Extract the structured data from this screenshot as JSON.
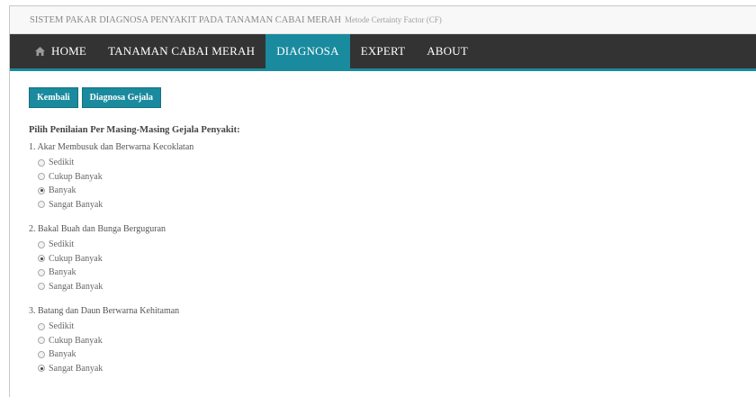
{
  "header": {
    "title": "SISTEM PAKAR DIAGNOSA PENYAKIT PADA TANAMAN CABAI MERAH",
    "subtitle": "Metode Certainty Factor (CF)"
  },
  "nav": {
    "items": [
      {
        "label": "HOME",
        "icon": "home-icon"
      },
      {
        "label": "TANAMAN CABAI MERAH"
      },
      {
        "label": "DIAGNOSA"
      },
      {
        "label": "EXPERT"
      },
      {
        "label": "ABOUT"
      }
    ],
    "active_index": 2,
    "accent_color": "#1a8a9e",
    "bar_color": "#333333"
  },
  "buttons": {
    "back": "Kembali",
    "diagnose": "Diagnosa Gejala"
  },
  "form": {
    "heading": "Pilih Penilaian Per Masing-Masing Gejala Penyakit:",
    "questions": [
      {
        "label": "1. Akar Membusuk dan Berwarna Kecoklatan",
        "options": [
          "Sedikit",
          "Cukup Banyak",
          "Banyak",
          "Sangat Banyak"
        ],
        "selected": 2
      },
      {
        "label": "2. Bakal Buah dan Bunga Berguguran",
        "options": [
          "Sedikit",
          "Cukup Banyak",
          "Banyak",
          "Sangat Banyak"
        ],
        "selected": 1
      },
      {
        "label": "3. Batang dan Daun Berwarna Kehitaman",
        "options": [
          "Sedikit",
          "Cukup Banyak",
          "Banyak",
          "Sangat Banyak"
        ],
        "selected": 3
      }
    ]
  }
}
